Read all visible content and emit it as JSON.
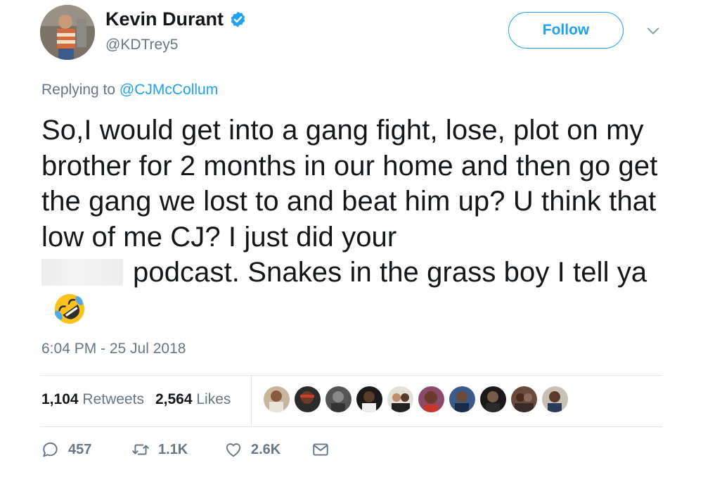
{
  "author": {
    "name": "Kevin Durant",
    "handle": "@KDTrey5",
    "verified": true
  },
  "follow_button": {
    "label": "Follow"
  },
  "reply": {
    "prefix": "Replying to",
    "mention": "@CJMcCollum"
  },
  "tweet": {
    "text_part1": "So,I would get into a gang fight, lose, plot on my brother for 2 months in our home and then go get the gang we lost to and beat him up? U think that low of me CJ? I just did your",
    "text_part2": "podcast. Snakes in the grass boy I tell ya",
    "emoji": "rolling-on-floor-laughing"
  },
  "timestamp": "6:04 PM - 25 Jul 2018",
  "stats": {
    "retweets_count": "1,104",
    "retweets_label": "Retweets",
    "likes_count": "2,564",
    "likes_label": "Likes"
  },
  "actions": {
    "replies": "457",
    "retweets": "1.1K",
    "likes": "2.6K"
  },
  "colors": {
    "accent": "#1da1f2",
    "secondary_text": "#657786",
    "primary_text": "#14171a",
    "divider": "#e1e8ed"
  }
}
